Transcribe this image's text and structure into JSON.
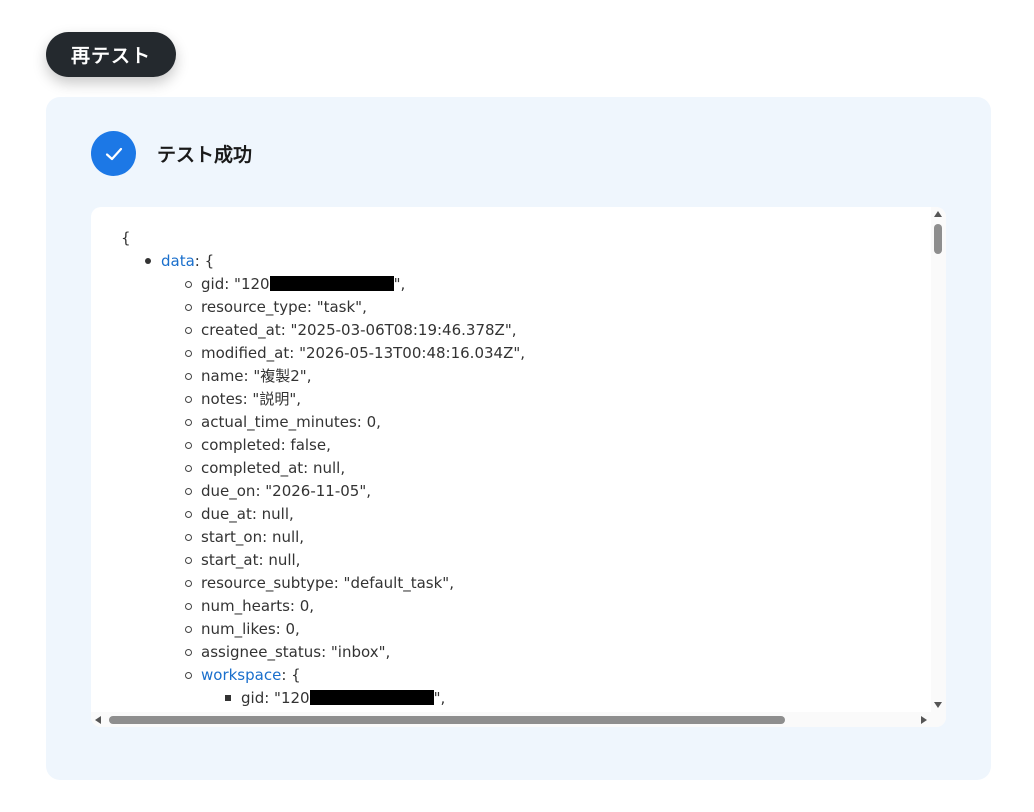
{
  "retest_button": {
    "label": "再テスト"
  },
  "status": {
    "text": "テスト成功",
    "icon": "check-icon"
  },
  "json_view": {
    "open_brace": "{",
    "lines": [
      {
        "level": 1,
        "key": "data",
        "link": true,
        "value": ": {"
      },
      {
        "level": 2,
        "key": "gid",
        "link": false,
        "value": ": \"120",
        "redacted": true,
        "tail": "\","
      },
      {
        "level": 2,
        "key": "resource_type",
        "link": false,
        "value": ": \"task\","
      },
      {
        "level": 2,
        "key": "created_at",
        "link": false,
        "value": ": \"2025-03-06T08:19:46.378Z\","
      },
      {
        "level": 2,
        "key": "modified_at",
        "link": false,
        "value": ": \"2026-05-13T00:48:16.034Z\","
      },
      {
        "level": 2,
        "key": "name",
        "link": false,
        "value": ": \"複製2\","
      },
      {
        "level": 2,
        "key": "notes",
        "link": false,
        "value": ": \"説明\","
      },
      {
        "level": 2,
        "key": "actual_time_minutes",
        "link": false,
        "value": ": 0,"
      },
      {
        "level": 2,
        "key": "completed",
        "link": false,
        "value": ": false,"
      },
      {
        "level": 2,
        "key": "completed_at",
        "link": false,
        "value": ": null,"
      },
      {
        "level": 2,
        "key": "due_on",
        "link": false,
        "value": ": \"2026-11-05\","
      },
      {
        "level": 2,
        "key": "due_at",
        "link": false,
        "value": ": null,"
      },
      {
        "level": 2,
        "key": "start_on",
        "link": false,
        "value": ": null,"
      },
      {
        "level": 2,
        "key": "start_at",
        "link": false,
        "value": ": null,"
      },
      {
        "level": 2,
        "key": "resource_subtype",
        "link": false,
        "value": ": \"default_task\","
      },
      {
        "level": 2,
        "key": "num_hearts",
        "link": false,
        "value": ": 0,"
      },
      {
        "level": 2,
        "key": "num_likes",
        "link": false,
        "value": ": 0,"
      },
      {
        "level": 2,
        "key": "assignee_status",
        "link": false,
        "value": ": \"inbox\","
      },
      {
        "level": 2,
        "key": "workspace",
        "link": true,
        "value": ": {"
      },
      {
        "level": 3,
        "key": "gid",
        "link": false,
        "value": ": \"120",
        "redacted": true,
        "tail": "\","
      }
    ]
  },
  "colors": {
    "accent": "#1c78e6",
    "link": "#1a6fcc",
    "panel": "#eff6fd",
    "button": "#24292e"
  }
}
